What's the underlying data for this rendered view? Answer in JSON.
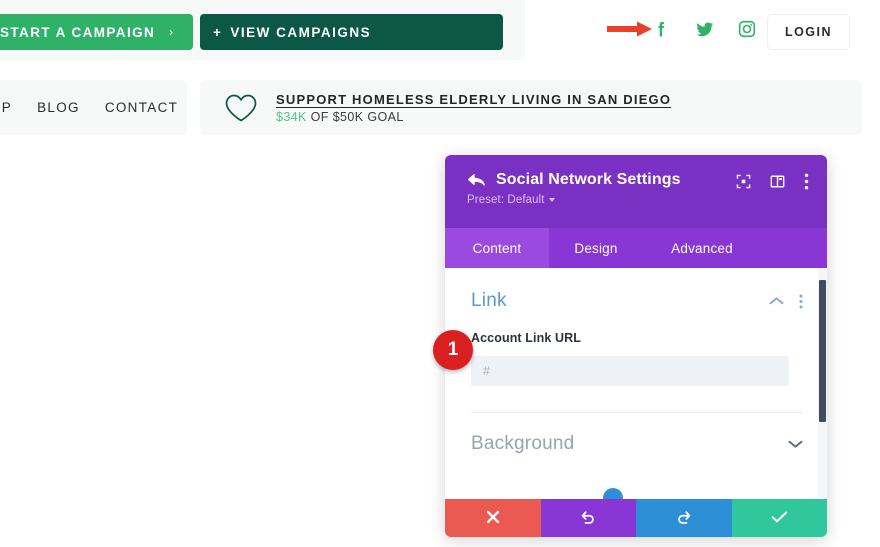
{
  "site_header": {
    "buttons": {
      "start_campaign": "START A CAMPAIGN",
      "start_campaign_chevron": "›",
      "view_campaigns": "VIEW CAMPAIGNS",
      "view_campaigns_plus": "+",
      "login": "LOGIN"
    },
    "social": [
      {
        "name": "facebook-icon",
        "label": "Facebook"
      },
      {
        "name": "twitter-icon",
        "label": "Twitter"
      },
      {
        "name": "instagram-icon",
        "label": "Instagram"
      }
    ],
    "nav_links": [
      "OP",
      "BLOG",
      "CONTACT"
    ],
    "support_banner": {
      "title": "SUPPORT HOMELESS ELDERLY LIVING IN SAN DIEGO",
      "raised": "$34K",
      "goal_text": " OF $50K GOAL"
    },
    "colors": {
      "green": "#2fb268",
      "dark_green": "#0d5747",
      "panel_bg": "#f7f8f8",
      "amount_green": "#4fc98a"
    }
  },
  "annotation": {
    "step_badge": "1",
    "badge_color": "#d91f1f",
    "arrow_color": "#e8402a"
  },
  "modal": {
    "title": "Social Network Settings",
    "preset_label": "Preset: Default",
    "header_icons": [
      {
        "name": "expand-icon"
      },
      {
        "name": "layout-panel-icon"
      },
      {
        "name": "more-vertical-icon"
      }
    ],
    "tabs": [
      {
        "label": "Content",
        "active": true
      },
      {
        "label": "Design",
        "active": false
      },
      {
        "label": "Advanced",
        "active": false
      }
    ],
    "sections": {
      "link": {
        "title": "Link",
        "field_label": "Account Link URL",
        "field_value": "",
        "field_placeholder": "#"
      },
      "background": {
        "title": "Background"
      }
    },
    "footer_buttons": [
      {
        "name": "cancel-button",
        "icon": "close-icon",
        "color": "#ea5a52"
      },
      {
        "name": "undo-button",
        "icon": "undo-icon",
        "color": "#8836d4"
      },
      {
        "name": "redo-button",
        "icon": "redo-icon",
        "color": "#2d8fd5"
      },
      {
        "name": "save-button",
        "icon": "check-icon",
        "color": "#2fc79b"
      }
    ],
    "colors": {
      "header_purple": "#7b30c4",
      "tabbar_purple": "#8836d4",
      "tab_active_purple": "#9a4ade",
      "link_blue": "#5a9ad1"
    }
  }
}
